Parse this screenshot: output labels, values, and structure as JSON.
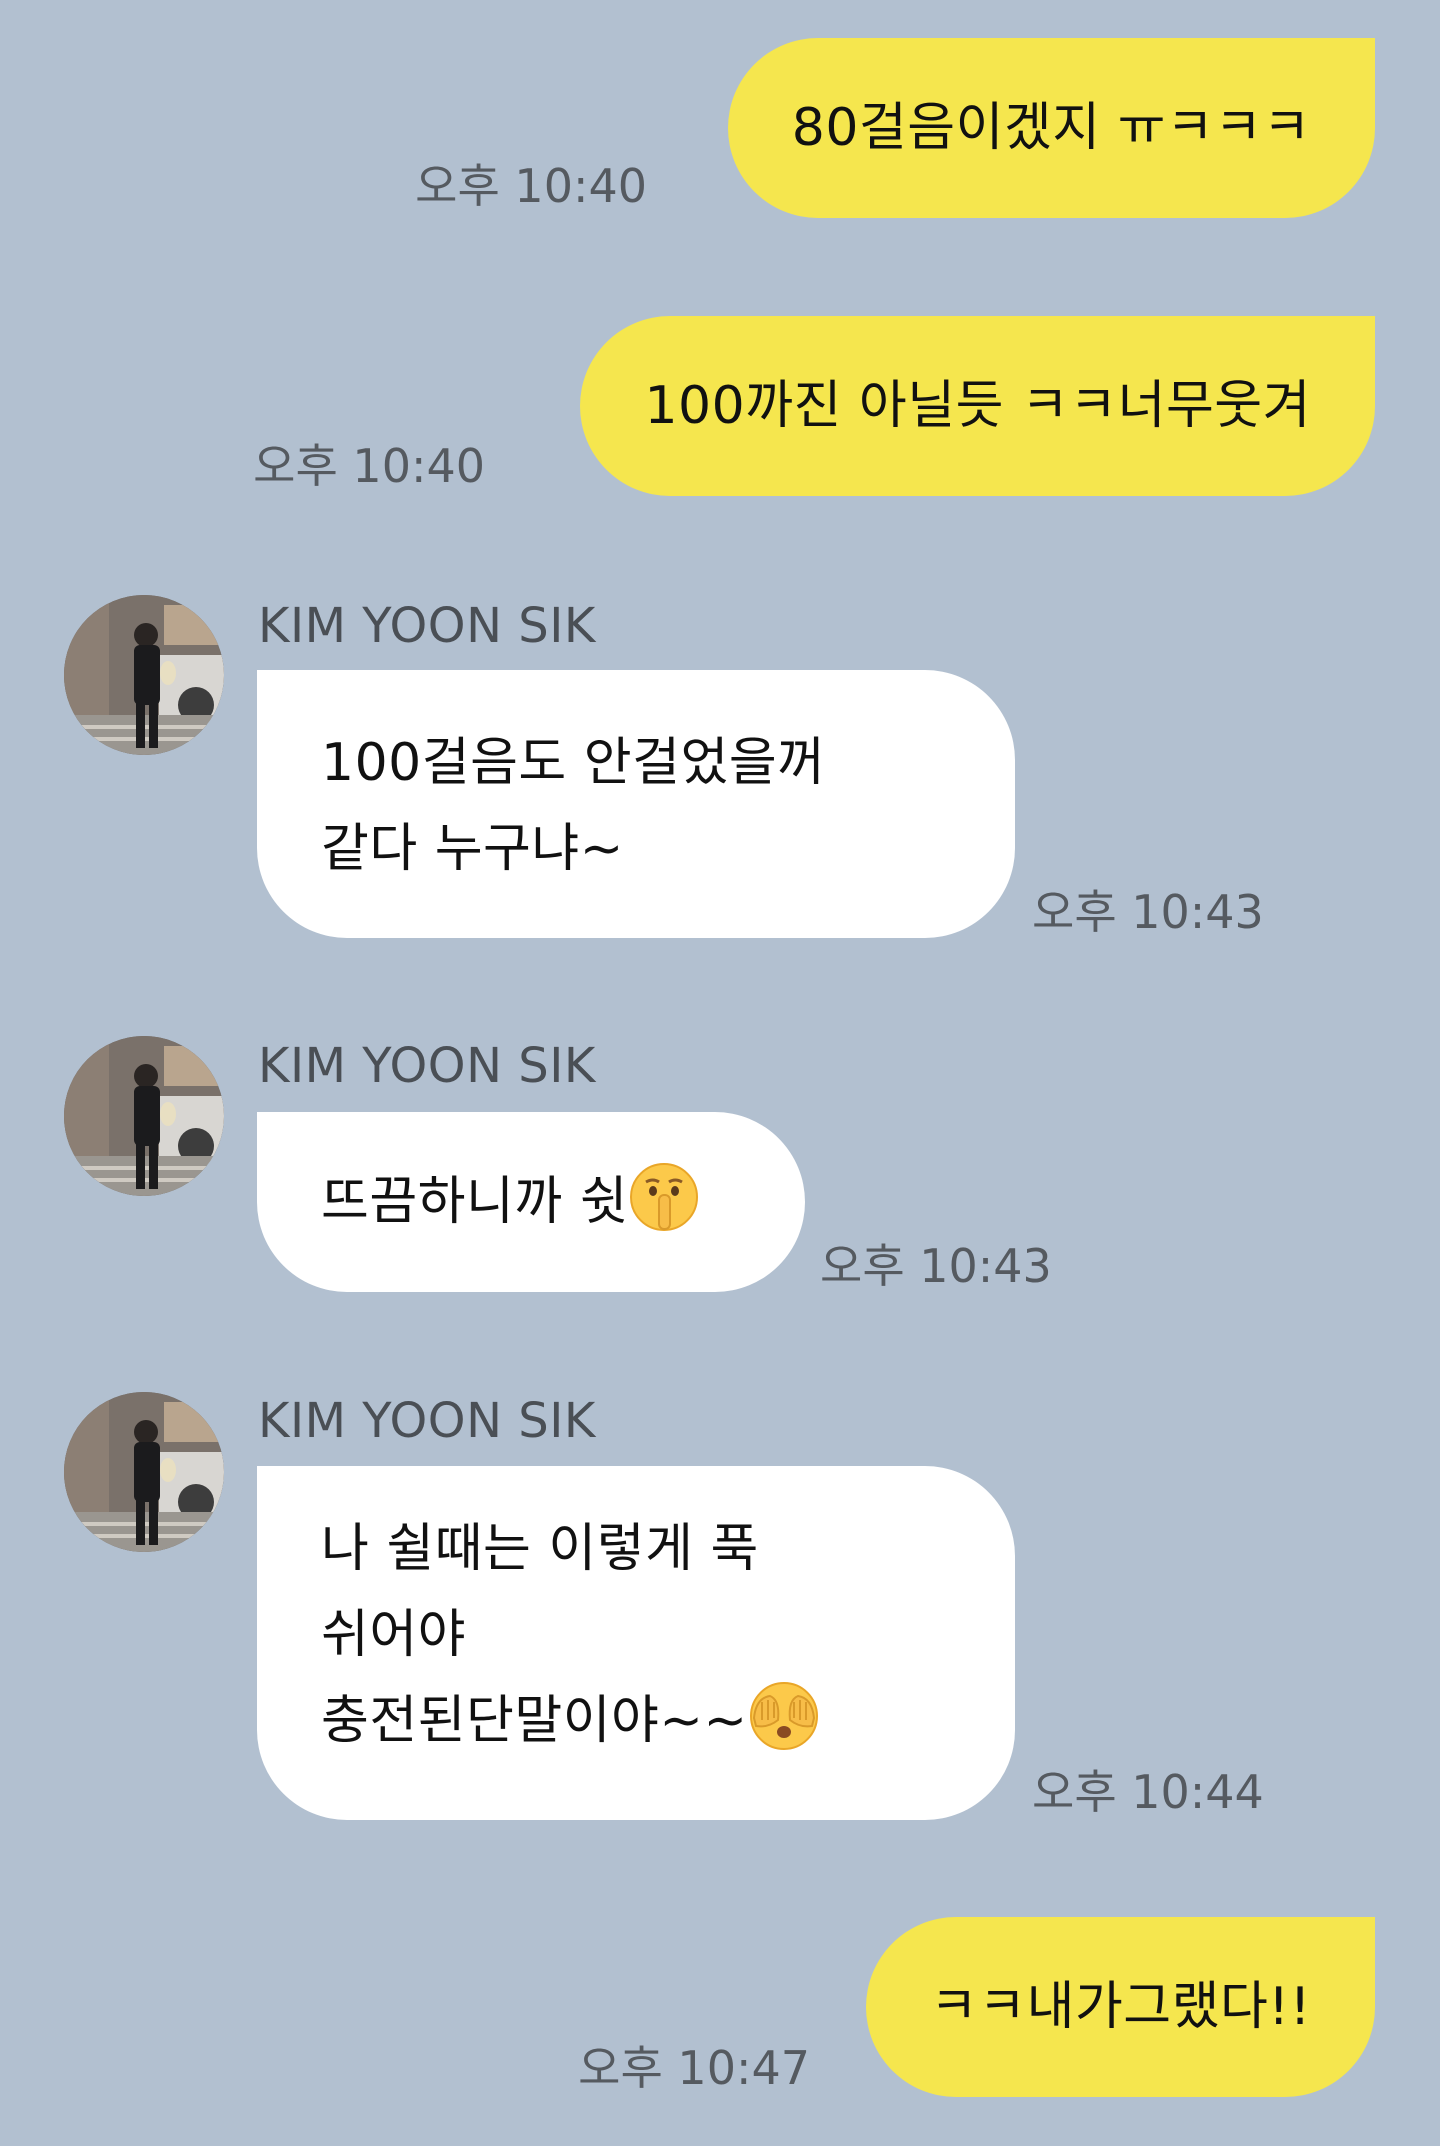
{
  "messages": [
    {
      "sender": "me",
      "text": "80걸음이겠지 ㅠㅋㅋㅋ",
      "time": "오후 10:40"
    },
    {
      "sender": "me",
      "text": "100까진 아닐듯 ㅋㅋ너무웃겨",
      "time": "오후 10:40"
    },
    {
      "sender": "KIM YOON SIK",
      "lines": [
        "100걸음도 안걸었을꺼",
        "같다 누구냐~"
      ],
      "time": "오후 10:43"
    },
    {
      "sender": "KIM YOON SIK",
      "lines": [
        "뜨끔하니까 쉿"
      ],
      "emoji": "shushing-face-emoji",
      "time": "오후 10:43"
    },
    {
      "sender": "KIM YOON SIK",
      "lines": [
        "나 쉴때는 이렇게 푹",
        "쉬어야",
        "충전된단말이야~~"
      ],
      "emoji": "see-no-evil-face-emoji",
      "time": "오후 10:44"
    },
    {
      "sender": "me",
      "text": "ㅋㅋ내가그랬다!!",
      "time": "오후 10:47"
    }
  ],
  "colors": {
    "background": "#b2c0d0",
    "my_bubble": "#f5e64e",
    "other_bubble": "#ffffff",
    "timestamp": "#555a60",
    "name": "#4a4f55"
  }
}
